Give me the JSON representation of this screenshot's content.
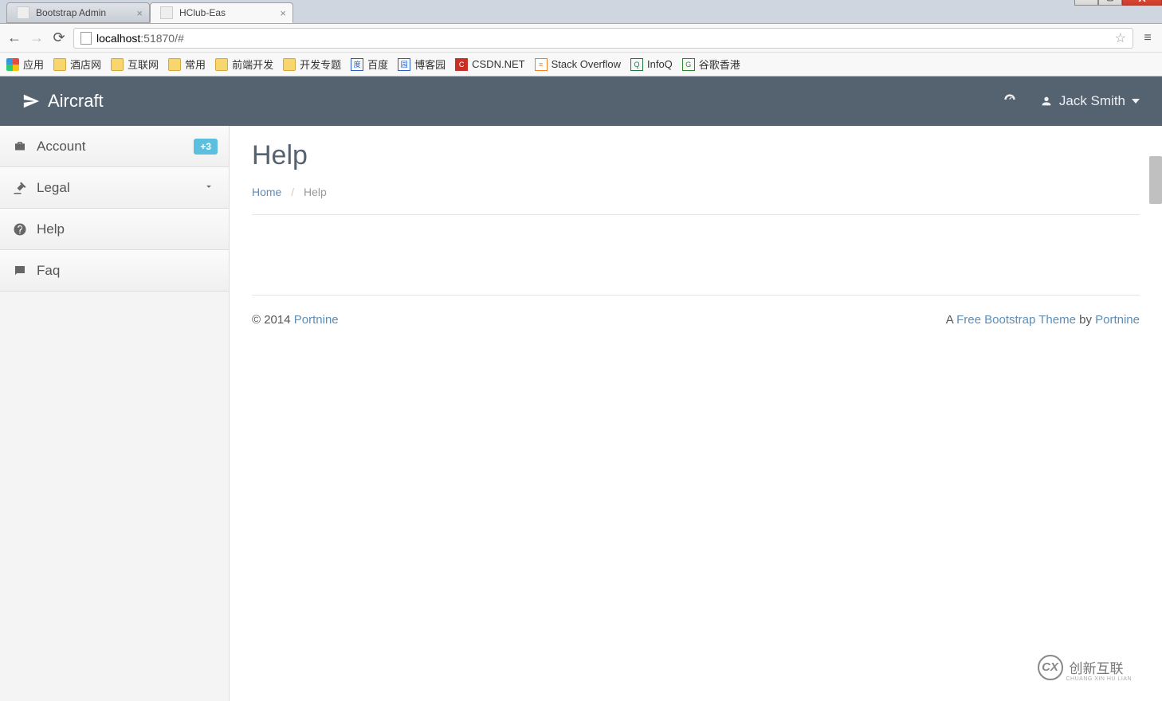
{
  "browser": {
    "tabs": [
      {
        "title": "Bootstrap Admin",
        "active": false
      },
      {
        "title": "HClub-Eas",
        "active": true
      }
    ],
    "url_host": "localhost",
    "url_port": ":51870",
    "url_path": "/#",
    "bookmarks": [
      {
        "label": "应用",
        "icon": "apps"
      },
      {
        "label": "酒店网",
        "icon": "folder"
      },
      {
        "label": "互联网",
        "icon": "folder"
      },
      {
        "label": "常用",
        "icon": "folder"
      },
      {
        "label": "前端开发",
        "icon": "folder"
      },
      {
        "label": "开发专题",
        "icon": "folder"
      },
      {
        "label": "百度",
        "icon": "baidu"
      },
      {
        "label": "博客园",
        "icon": "cnblogs"
      },
      {
        "label": "CSDN.NET",
        "icon": "csdn"
      },
      {
        "label": "Stack Overflow",
        "icon": "so"
      },
      {
        "label": "InfoQ",
        "icon": "infoq"
      },
      {
        "label": "谷歌香港",
        "icon": "google"
      }
    ]
  },
  "app": {
    "brand": "Aircraft",
    "user_name": "Jack Smith"
  },
  "sidebar": {
    "items": [
      {
        "label": "Account",
        "icon": "briefcase",
        "badge": "+3"
      },
      {
        "label": "Legal",
        "icon": "gavel",
        "expandable": true
      },
      {
        "label": "Help",
        "icon": "question"
      },
      {
        "label": "Faq",
        "icon": "comment"
      }
    ]
  },
  "main": {
    "title": "Help",
    "breadcrumb_home": "Home",
    "breadcrumb_current": "Help"
  },
  "footer": {
    "copyright_prefix": "© 2014 ",
    "copyright_link": "Portnine",
    "right_prefix": "A ",
    "right_link1": "Free Bootstrap Theme",
    "right_mid": " by ",
    "right_link2": "Portnine"
  },
  "watermark": {
    "text": "创新互联",
    "sub": "CHUANG XIN HU LIAN",
    "mark": "CX"
  }
}
